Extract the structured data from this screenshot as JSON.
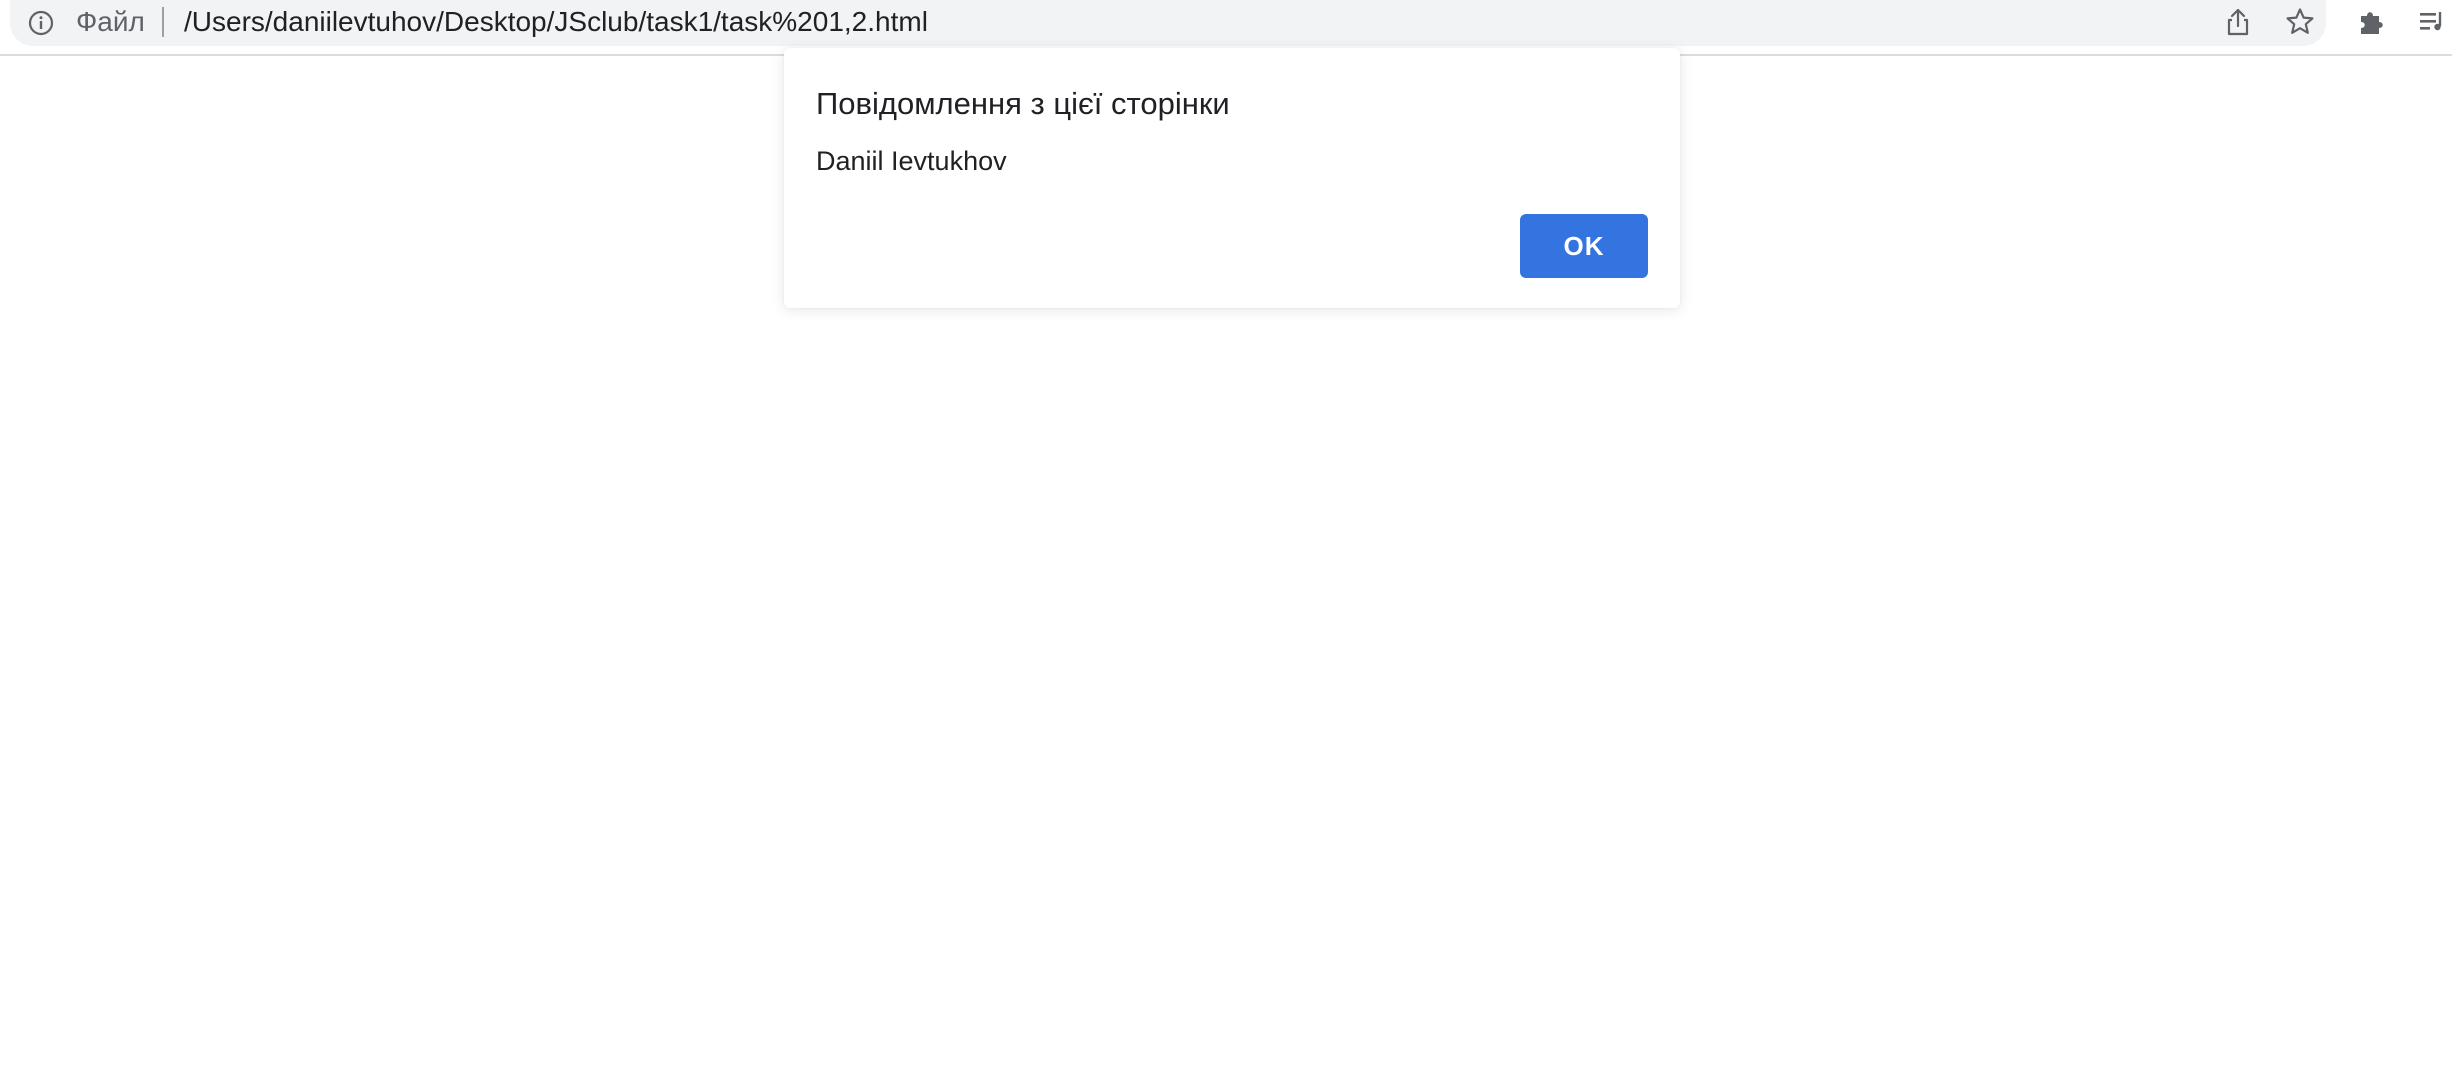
{
  "browser": {
    "scheme_label": "Файл",
    "url": "/Users/daniilevtuhov/Desktop/JSclub/task1/task%201,2.html",
    "icons": {
      "info": "info-icon",
      "share": "share-icon",
      "bookmark": "star-icon",
      "extensions": "puzzle-icon",
      "media": "media-control-icon"
    }
  },
  "dialog": {
    "title": "Повідомлення з цієї сторінки",
    "message": "Daniil Ievtukhov",
    "ok_label": "OK"
  },
  "colors": {
    "accent": "#3474e0",
    "toolbar_bg": "#f1f3f4",
    "text": "#202124",
    "muted_text": "#5f6368"
  }
}
